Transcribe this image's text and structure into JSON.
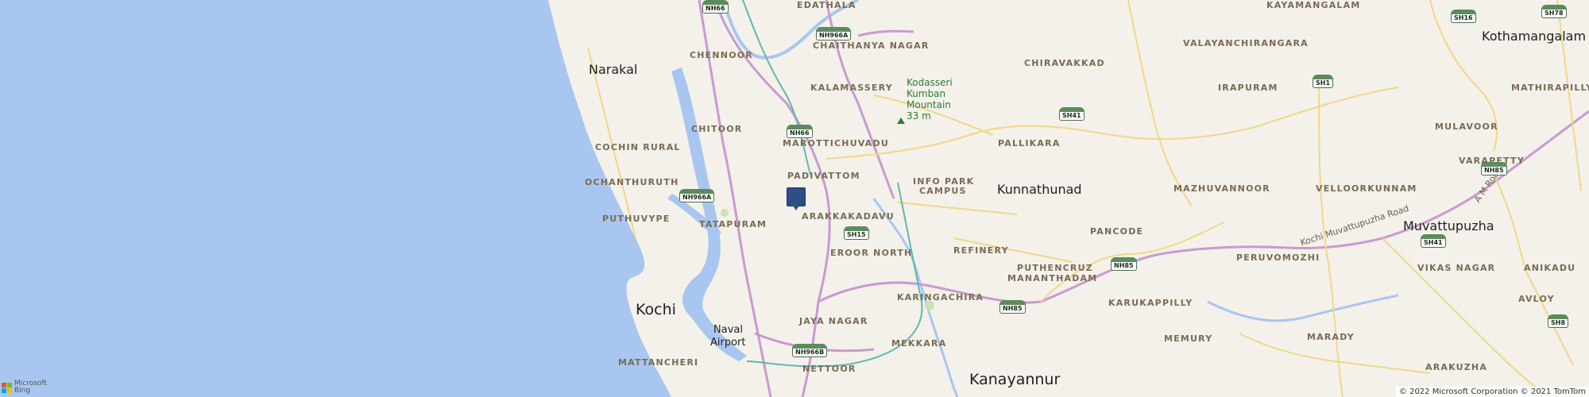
{
  "map": {
    "colors": {
      "sea": "#a9c6f0",
      "land": "#f3f1ea",
      "highway": "#c99ad0",
      "road": "#f0d885",
      "water_inland": "#a9c6f0",
      "pin": "#2d4f86",
      "green_area": "#c9e3b6"
    },
    "cities": [
      {
        "key": "narakal",
        "label": "Narakal"
      },
      {
        "key": "kochi",
        "label": "Kochi"
      },
      {
        "key": "kunnathunad",
        "label": "Kunnathunad"
      },
      {
        "key": "muvattupuzha",
        "label": "Muvattupuzha"
      },
      {
        "key": "kothamangalam",
        "label": "Kothamangalam"
      },
      {
        "key": "kanayannur",
        "label": "Kanayannur"
      }
    ],
    "areas": [
      "CHENNOOR",
      "CHAITHANYA NAGAR",
      "CHIRAVAKKAD",
      "VALAYANCHIRANGARA",
      "KALAMASSERY",
      "IRAPURAM",
      "MATHIRAPILLY",
      "CHITOOR",
      "MAROTTICHUVADU",
      "PALLIKARA",
      "MULAVOOR",
      "COCHIN RURAL",
      "PADIVATTOM",
      "INFO PARK",
      "CAMPUS",
      "OCHANTHURUTH",
      "MAZHUVANNOOR",
      "VELLOORKUNNAM",
      "VARAPETTY",
      "PUTHUVYPE",
      "TATAPURAM",
      "ARAKKAKADAVU",
      "PANCODE",
      "EROOR NORTH",
      "REFINERY",
      "PUTHENCRUZ",
      "PERUVOMOZHI",
      "MANANTHADAM",
      "VIKAS NAGAR",
      "ANIKADU",
      "KARINGACHIRA",
      "KARUKAPPILLY",
      "AVLOY",
      "JAYA NAGAR",
      "MEMURY",
      "MARADY",
      "MATTANCHERI",
      "MEKKARA",
      "NETTOOR",
      "ARAKUZHA",
      "KAYAMANGALAM",
      "EDATHALA"
    ],
    "poi": {
      "name_lines": [
        "Kodasseri",
        "Kumban",
        "Mountain"
      ],
      "elevation": "33 m"
    },
    "extra_labels": [
      "Naval",
      "Airport"
    ],
    "road_names": [
      "Kochi Muvattupuzha Road",
      "A M Road"
    ],
    "shields": [
      "NH66",
      "NH966A",
      "NH66",
      "NH966A",
      "SH15",
      "NH966B",
      "NH85",
      "NH85",
      "SH41",
      "SH1",
      "SH16",
      "SH78",
      "NH85",
      "SH41",
      "SH8"
    ],
    "brand": {
      "line1": "Microsoft",
      "line2": "Bing"
    },
    "copyright": "© 2022 Microsoft Corporation © 2021 TomTom"
  }
}
